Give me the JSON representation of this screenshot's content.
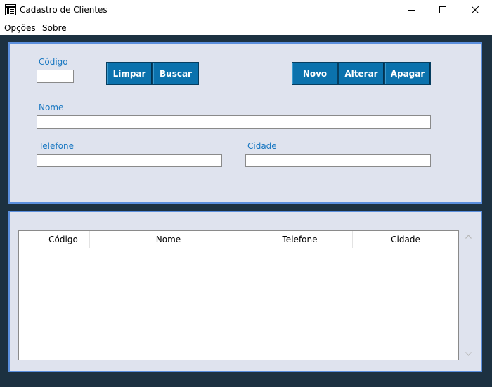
{
  "window": {
    "title": "Cadastro de Clientes",
    "minimize_icon": "minimize-icon",
    "maximize_icon": "maximize-icon",
    "close_icon": "close-icon"
  },
  "menu": {
    "items": [
      "Opções",
      "Sobre"
    ]
  },
  "form": {
    "codigo_label": "Código",
    "codigo_value": "",
    "nome_label": "Nome",
    "nome_value": "",
    "telefone_label": "Telefone",
    "telefone_value": "",
    "cidade_label": "Cidade",
    "cidade_value": "",
    "buttons": {
      "limpar": "Limpar",
      "buscar": "Buscar",
      "novo": "Novo",
      "alterar": "Alterar",
      "apagar": "Apagar"
    }
  },
  "table": {
    "columns": [
      "",
      "Código",
      "Nome",
      "Telefone",
      "Cidade"
    ],
    "rows": []
  },
  "colors": {
    "accent_button": "#0b72ad",
    "panel_bg": "#dfe3ee",
    "panel_border": "#5b8fdd",
    "label_text": "#1a78c2",
    "window_bg": "#1c3141"
  }
}
